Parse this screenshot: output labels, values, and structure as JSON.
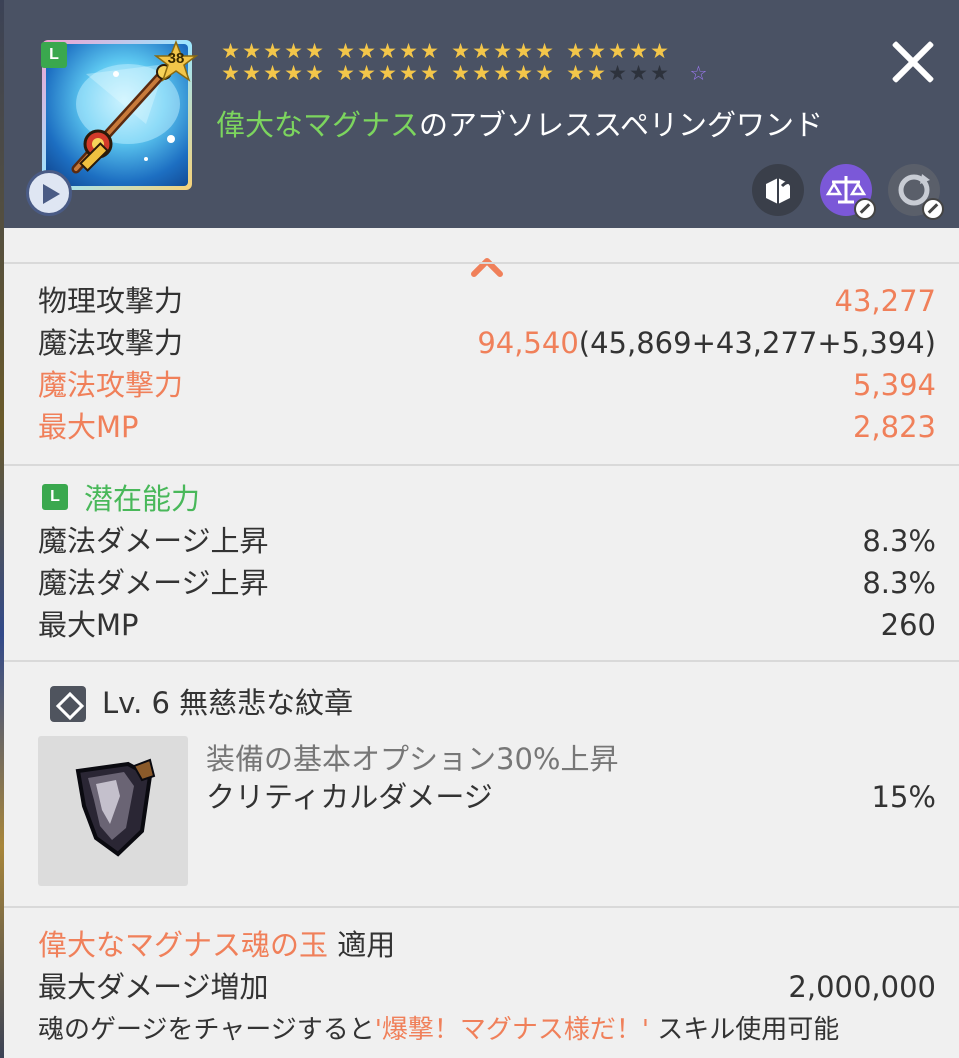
{
  "item": {
    "grade_badge": "L",
    "level": "38",
    "name_prefix": "偉大なマグナス",
    "name_suffix": "のアブソレススペリングワンド",
    "starforce": {
      "row1_groups": [
        5,
        5,
        5,
        5
      ],
      "row2_groups": [
        5,
        5,
        5,
        5
      ],
      "filled_total": 37,
      "max_total": 40,
      "extra_star": "outline-star"
    }
  },
  "header_icons": [
    "transfer-icon",
    "scale-icon",
    "cycle-icon"
  ],
  "stats": [
    {
      "label": "物理攻撃力",
      "value": "43,277",
      "label_color": "default",
      "value_color": "orange"
    },
    {
      "label": "魔法攻撃力",
      "value_main": "94,540",
      "value_detail": "(45,869+43,277+5,394)",
      "label_color": "default"
    },
    {
      "label": "魔法攻撃力",
      "value": "5,394",
      "label_color": "orange",
      "value_color": "orange"
    },
    {
      "label": "最大MP",
      "value": "2,823",
      "label_color": "orange",
      "value_color": "orange"
    }
  ],
  "potential": {
    "badge": "L",
    "title": "潜在能力",
    "lines": [
      {
        "label": "魔法ダメージ上昇",
        "value": "8.3%"
      },
      {
        "label": "魔法ダメージ上昇",
        "value": "8.3%"
      },
      {
        "label": "最大MP",
        "value": "260"
      }
    ]
  },
  "emblem": {
    "title": "Lv. 6 無慈悲な紋章",
    "desc": "装備の基本オプション30%上昇",
    "stat_label": "クリティカルダメージ",
    "stat_value": "15%"
  },
  "soul": {
    "name": "偉大なマグナス魂の玉",
    "applied": " 適用",
    "stat_label": "最大ダメージ増加",
    "stat_value": "2,000,000",
    "desc_before": "魂のゲージをチャージすると",
    "desc_skill": "'爆撃！マグナス様だ！'",
    "desc_after": " スキル使用可能"
  },
  "colors": {
    "header_bg": "#4a5264",
    "panel_bg": "#f0f0f0",
    "accent_orange": "#f0805a",
    "accent_green": "#49b85a",
    "star_gold": "#f3c64a"
  }
}
